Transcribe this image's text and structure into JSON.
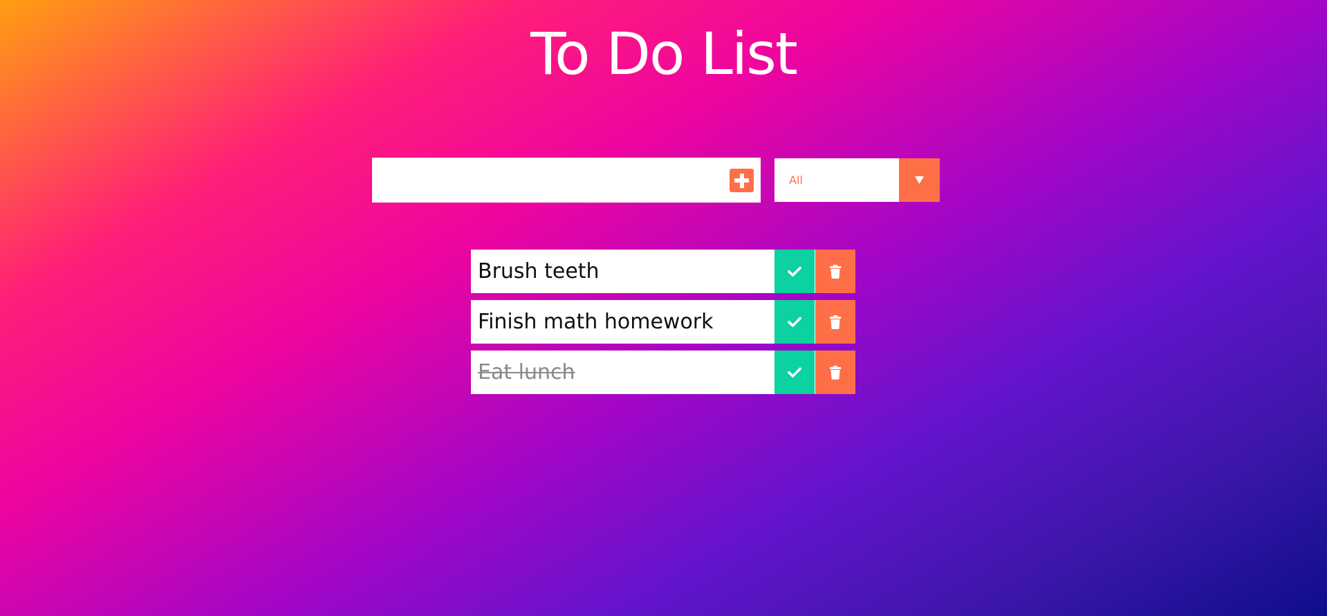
{
  "header": {
    "title": "To Do List"
  },
  "form": {
    "input_value": "",
    "input_placeholder": "",
    "add_icon": "plus-square-icon",
    "filter": {
      "selected": "All",
      "arrow_icon": "caret-down-icon"
    }
  },
  "todos": [
    {
      "text": "Brush teeth",
      "completed": false
    },
    {
      "text": "Finish math homework",
      "completed": false
    },
    {
      "text": "Eat lunch",
      "completed": true
    }
  ],
  "icons": {
    "complete": "check-icon",
    "delete": "trash-icon"
  },
  "colors": {
    "accent": "#ff6f47",
    "complete": "#0cd1a1",
    "completed_text": "#8a8a8a"
  }
}
